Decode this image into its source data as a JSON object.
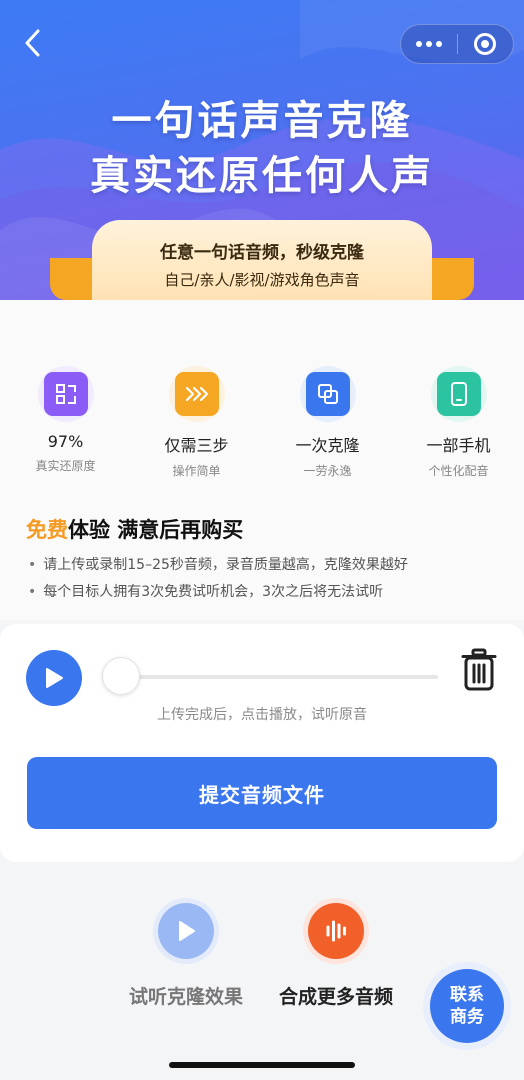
{
  "hero": {
    "title_line1": "一句话声音克隆",
    "title_line2": "真实还原任何人声",
    "ribbon_line1": "任意一句话音频，秒级克隆",
    "ribbon_line2": "自己/亲人/影视/游戏角色声音"
  },
  "nav": {
    "back_icon": "chevron-left-icon",
    "more_icon": "more-dots-icon",
    "close_icon": "target-icon"
  },
  "features": [
    {
      "name": "97%",
      "sub": "真实还原度",
      "icon": "scan-icon",
      "color": "#8b5cf6"
    },
    {
      "name": "仅需三步",
      "sub": "操作简单",
      "icon": "arrows-icon",
      "color": "#f5a623"
    },
    {
      "name": "一次克隆",
      "sub": "一劳永逸",
      "icon": "copy-icon",
      "color": "#3a77ee"
    },
    {
      "name": "一部手机",
      "sub": "个性化配音",
      "icon": "phone-icon",
      "color": "#2cc3a0"
    }
  ],
  "trial": {
    "highlight": "免费",
    "title_rest": "体验 满意后再购买",
    "tip1": "请上传或录制15–25秒音频，录音质量越高，克隆效果越好",
    "tip2": "每个目标人拥有3次免费试听机会，3次之后将无法试听"
  },
  "player": {
    "hint": "上传完成后，点击播放，试听原音",
    "submit_label": "提交音频文件",
    "progress": 0
  },
  "tabs": {
    "listen_label": "试听克隆效果",
    "synth_label": "合成更多音频"
  },
  "contact": {
    "line1": "联系",
    "line2": "商务"
  },
  "colors": {
    "primary": "#3a77ee",
    "accent_orange": "#f59a23",
    "synth_orange": "#f2602a"
  }
}
